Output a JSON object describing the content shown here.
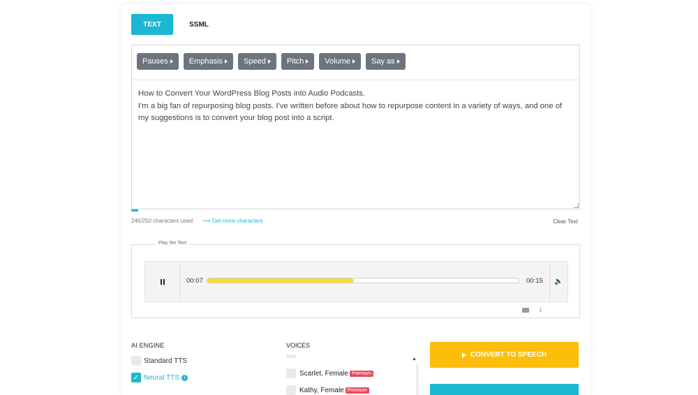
{
  "tabs": {
    "text": "TEXT",
    "ssml": "SSML"
  },
  "toolbar": [
    {
      "label": "Pauses"
    },
    {
      "label": "Emphasis"
    },
    {
      "label": "Speed"
    },
    {
      "label": "Pitch"
    },
    {
      "label": "Volume"
    },
    {
      "label": "Say as"
    }
  ],
  "editor": {
    "line1": "How to Convert Your WordPress Blog Posts into Audio Podcasts.",
    "line2": "I'm a big fan of repurposing blog posts. I've written before about how to repurpose content in a variety of ways, and one of",
    "line3": "my suggestions is to convert your blog post into a script."
  },
  "usage": {
    "chars": "246/250 characters used",
    "more": "⟶ Get more characters",
    "clear": "Clear Text"
  },
  "player": {
    "legend": "Play the Text",
    "current": "00:07",
    "total": "00:15",
    "progress": 0.47,
    "accent": "#f7dc34"
  },
  "engine": {
    "label": "AI ENGINE",
    "standard": "Standard TTS",
    "neural": "Neural TTS",
    "neural_checked": true
  },
  "voices": {
    "label": "VOICES",
    "items": [
      {
        "name": "Scarlet, Female",
        "badge": "Premium"
      },
      {
        "name": "Kathy, Female",
        "badge": "Premium"
      }
    ]
  },
  "actions": {
    "convert": "CONVERT TO SPEECH"
  },
  "colors": {
    "accent": "#1bb7d3",
    "convert": "#fbbe0a",
    "toolbar_btn": "#6c757d",
    "badge": "#e64a5b"
  }
}
